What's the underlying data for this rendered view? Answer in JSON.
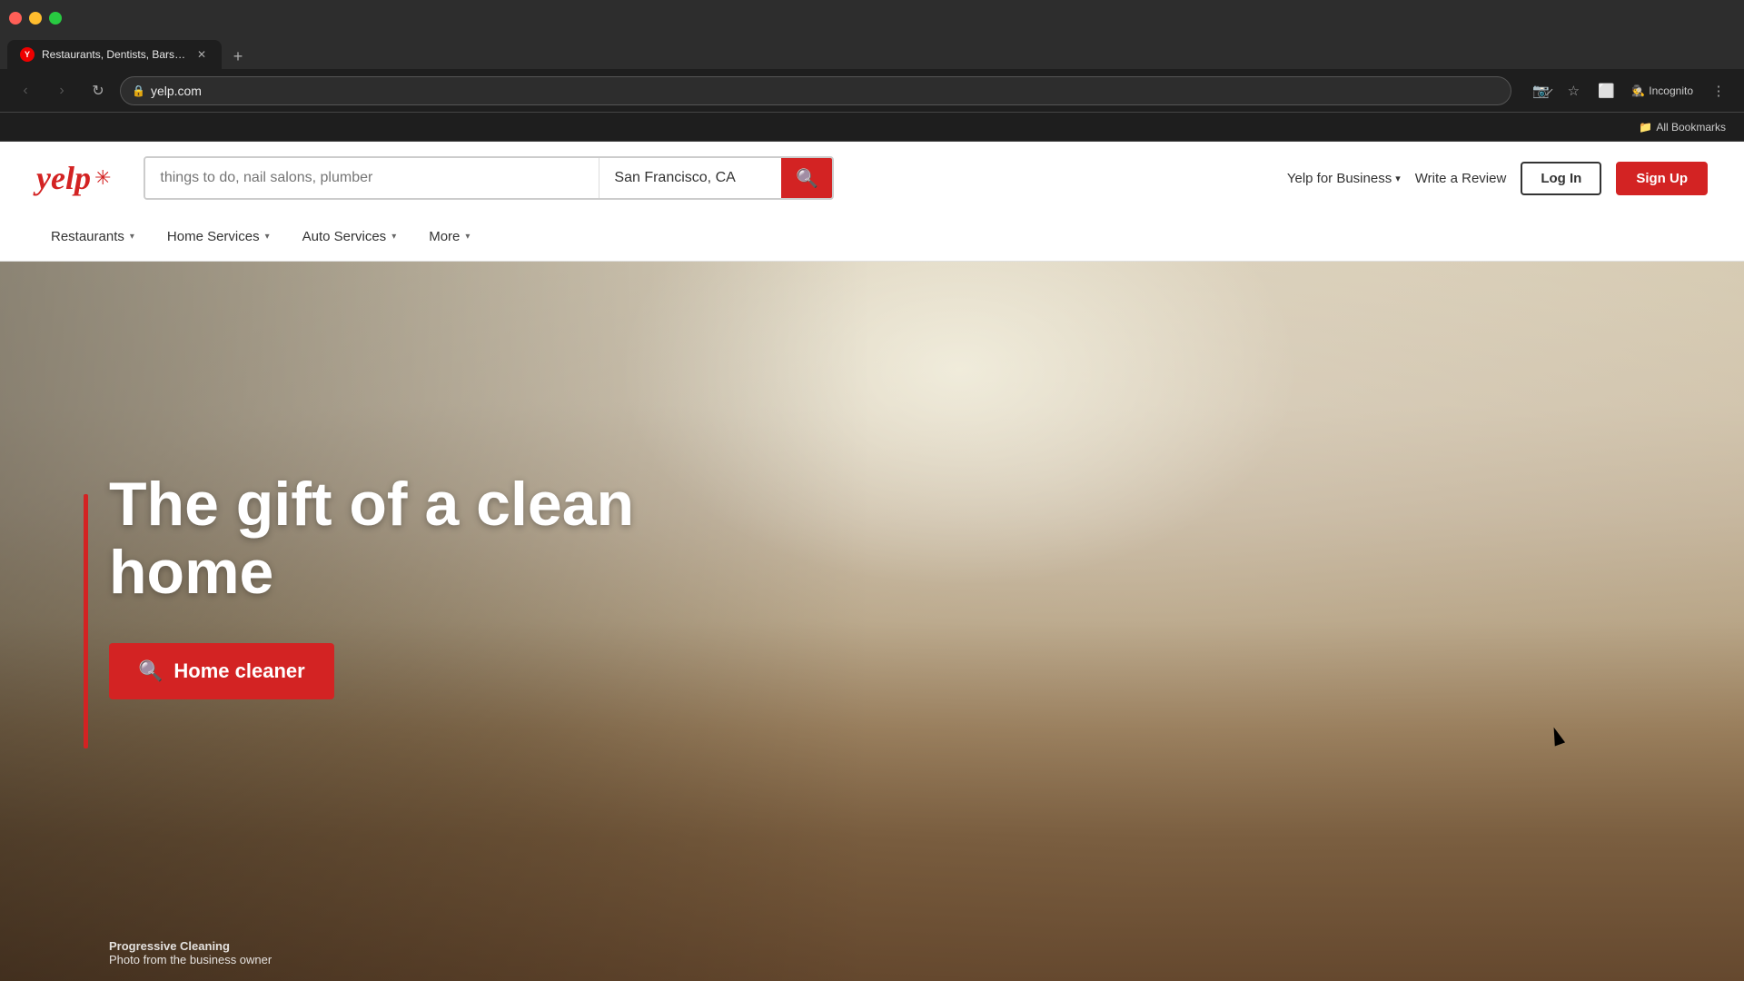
{
  "browser": {
    "tab_title": "Restaurants, Dentists, Bars, Bea",
    "tab_favicon": "Y",
    "address": "yelp.com",
    "nav": {
      "back_label": "‹",
      "forward_label": "›",
      "reload_label": "↺"
    },
    "incognito_label": "Incognito",
    "bookmarks_label": "All Bookmarks"
  },
  "yelp": {
    "logo_text": "yelp",
    "logo_burst": "✳",
    "search": {
      "what_placeholder": "things to do, nail salons, plumber",
      "what_value": "things to do, nail salons, plumber",
      "where_value": "San Francisco, CA",
      "search_icon": "🔍"
    },
    "header": {
      "yelp_for_business_label": "Yelp for Business",
      "write_review_label": "Write a Review",
      "login_label": "Log In",
      "signup_label": "Sign Up"
    },
    "nav": {
      "items": [
        {
          "label": "Restaurants",
          "has_chevron": true
        },
        {
          "label": "Home Services",
          "has_chevron": true
        },
        {
          "label": "Auto Services",
          "has_chevron": true
        },
        {
          "label": "More",
          "has_chevron": true
        }
      ]
    },
    "hero": {
      "title_line1": "The gift of a clean",
      "title_line2": "home",
      "cta_label": "Home cleaner",
      "photo_credit_name": "Progressive Cleaning",
      "photo_credit_caption": "Photo from the business owner"
    }
  }
}
